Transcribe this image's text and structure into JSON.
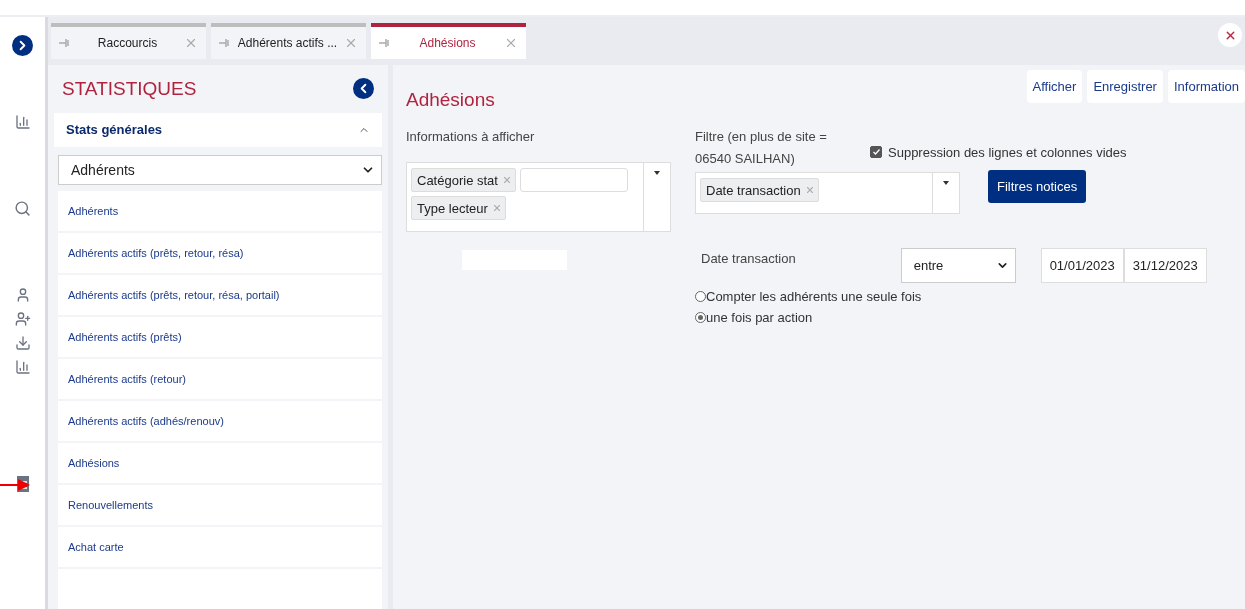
{
  "tabs": [
    {
      "label": "Raccourcis",
      "selected": false
    },
    {
      "label": "Adhérents actifs ...",
      "selected": false
    },
    {
      "label": "Adhésions",
      "selected": true
    }
  ],
  "sidebar": {
    "title": "STATISTIQUES",
    "section": {
      "label": "Stats générales",
      "expanded": true
    },
    "category": "Adhérents",
    "items": [
      {
        "label": "Adhérents"
      },
      {
        "label": "Adhérents actifs (prêts, retour, résa)"
      },
      {
        "label": "Adhérents actifs (prêts, retour, résa, portail)"
      },
      {
        "label": "Adhérents actifs (prêts)"
      },
      {
        "label": "Adhérents actifs (retour)"
      },
      {
        "label": "Adhérents actifs (adhés/renouv)"
      },
      {
        "label": "Adhésions"
      },
      {
        "label": "Renouvellements"
      },
      {
        "label": "Achat carte"
      }
    ]
  },
  "main": {
    "title": "Adhésions",
    "buttons": [
      "Afficher",
      "Enregistrer",
      "Information"
    ],
    "info_label": "Informations à afficher",
    "info_tags": [
      "Catégorie stat",
      "Type lecteur"
    ],
    "filter_label": "Filtre (en plus de site = 06540 SAILHAN)",
    "filter_tags": [
      "Date transaction"
    ],
    "checkbox": {
      "label": "Suppression des lignes et colonnes vides",
      "checked": true
    },
    "filter_button": "Filtres notices",
    "date_label": "Date transaction",
    "operator": "entre",
    "date_from": "01/01/2023",
    "date_to": "31/12/2023",
    "radios": [
      {
        "label": "Compter les adhérents une seule fois",
        "selected": false
      },
      {
        "label": "une fois par action",
        "selected": true
      }
    ]
  }
}
